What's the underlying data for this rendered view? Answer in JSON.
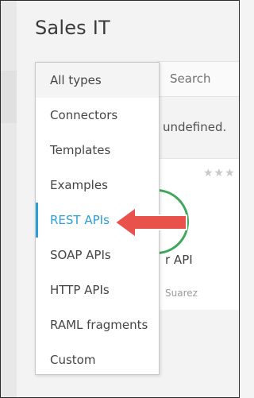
{
  "header": {
    "title": "Sales IT"
  },
  "search": {
    "placeholder": "Search"
  },
  "notice": {
    "text": "undefined."
  },
  "card": {
    "stars": "★★★",
    "title_fragment": "r API",
    "author_fragment": "Suarez"
  },
  "dropdown": {
    "items": [
      {
        "label": "All types"
      },
      {
        "label": "Connectors"
      },
      {
        "label": "Templates"
      },
      {
        "label": "Examples"
      },
      {
        "label": "REST APIs"
      },
      {
        "label": "SOAP APIs"
      },
      {
        "label": "HTTP APIs"
      },
      {
        "label": "RAML fragments"
      },
      {
        "label": "Custom"
      }
    ],
    "highlighted_item": "All types",
    "active_item": "REST APIs"
  },
  "colors": {
    "accent": "#2c9fd6",
    "arrow": "#e8524a",
    "logo_ring": "#3ea85a"
  },
  "icons": {
    "pointer_arrow": "left-arrow-icon"
  }
}
